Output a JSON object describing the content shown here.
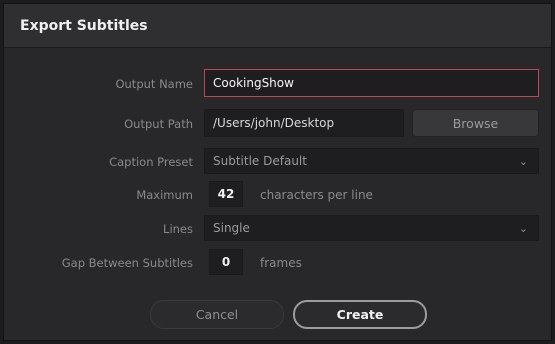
{
  "dialog": {
    "title": "Export Subtitles"
  },
  "output_name": {
    "label": "Output Name",
    "value": "CookingShow"
  },
  "output_path": {
    "label": "Output Path",
    "value": "/Users/john/Desktop",
    "browse_label": "Browse"
  },
  "caption_preset": {
    "label": "Caption Preset",
    "value": "Subtitle Default"
  },
  "maximum": {
    "label": "Maximum",
    "value": "42",
    "suffix": "characters per line"
  },
  "lines": {
    "label": "Lines",
    "value": "Single"
  },
  "gap": {
    "label": "Gap Between Subtitles",
    "value": "0",
    "suffix": "frames"
  },
  "buttons": {
    "cancel": "Cancel",
    "create": "Create"
  },
  "icons": {
    "dropdown": "chevron-down-icon"
  },
  "colors": {
    "highlight_border": "#c0484e",
    "background": "#28282a"
  }
}
